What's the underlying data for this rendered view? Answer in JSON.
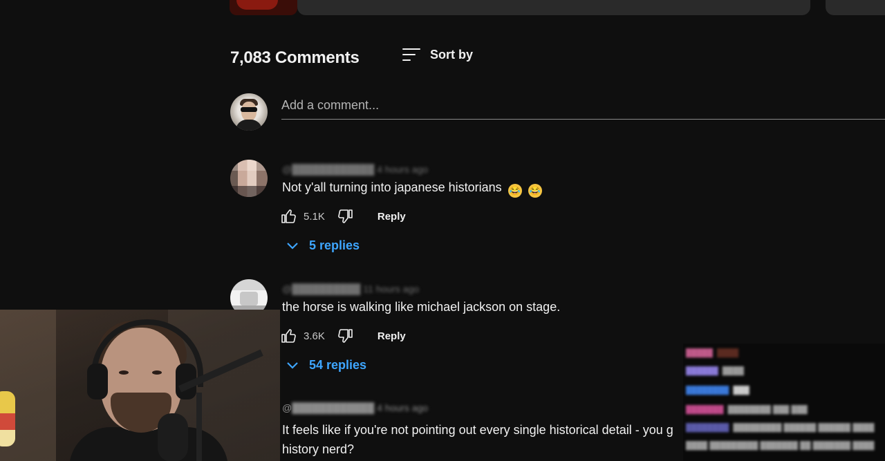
{
  "header": {
    "comments_count": "7,083 Comments",
    "sort_label": "Sort by"
  },
  "add_comment": {
    "placeholder": "Add a comment..."
  },
  "comments": [
    {
      "meta": "@████████████ 4 hours ago",
      "text": "Not y'all turning into japanese historians",
      "emojis": [
        "😂",
        "😂"
      ],
      "likes": "5.1K",
      "reply_label": "Reply",
      "replies": "5 replies"
    },
    {
      "meta": "@██████████ 11 hours ago",
      "text": "the horse is walking like michael jackson on stage.",
      "likes": "3.6K",
      "reply_label": "Reply",
      "replies": "54 replies"
    },
    {
      "meta_prefix": "@",
      "meta": "████████████ 4 hours ago",
      "text": "It feels like if you're not pointing out every single historical detail - you g",
      "text_line2": "history nerd?"
    }
  ],
  "colors": {
    "background": "#0f0f0f",
    "link_blue": "#3ea6ff",
    "text": "#f1f1f1",
    "muted": "#aaaaaa"
  }
}
